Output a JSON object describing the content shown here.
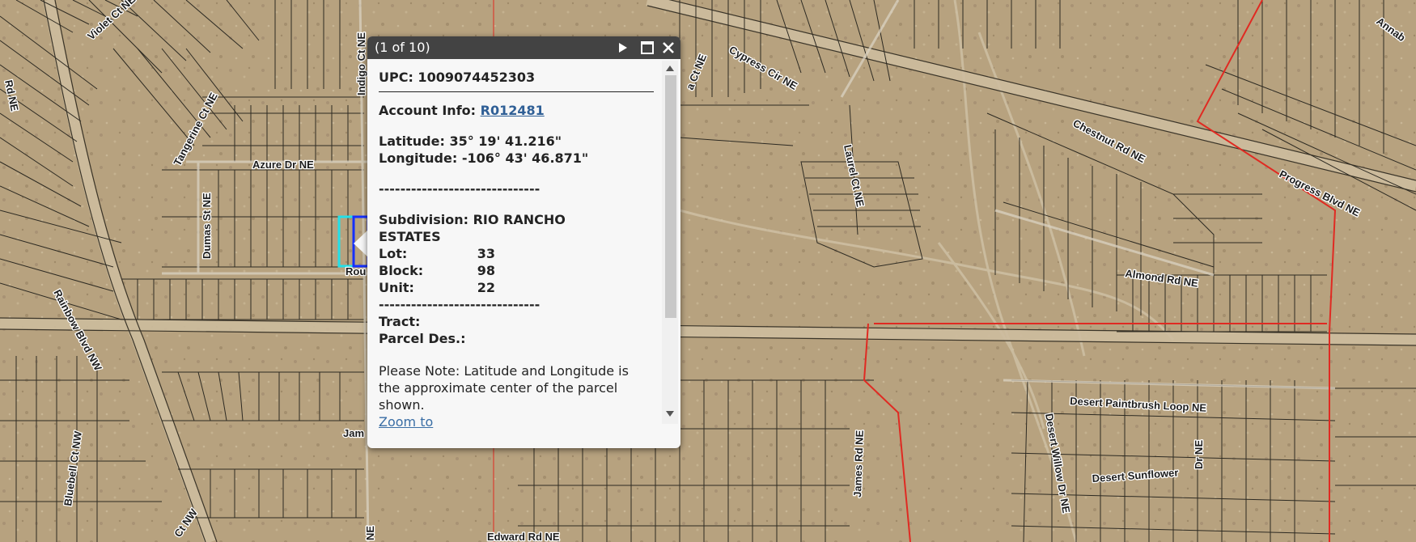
{
  "map": {
    "labels": {
      "violet_ct": "Violet Ct NE",
      "indigo_ct": "Indigo Ct NE",
      "tangerine_ct": "Tangerine Ct NE",
      "azure_dr": "Azure Dr NE",
      "dumas_st": "Dumas St NE",
      "rd_ne_left": "Rd NE",
      "rainbow_blvd": "Rainbow Blvd NW",
      "cypress_cir": "Cypress Cir NE",
      "a_ct": "a Ct NE",
      "laurel_ct": "Laurel Ct NE",
      "chestnut_rd": "Chestnut Rd NE",
      "progress_blvd": "Progress Blvd NE",
      "almond_rd": "Almond Rd NE",
      "desert_paintbrush": "Desert Paintbrush Loop NE",
      "desert_willow": "Desert Willow Dr NE",
      "desert_sunflower": "Desert Sunflower",
      "dr_ne": "Dr NE",
      "james_rd": "James Rd NE",
      "edward_rd": "Edward Rd NE",
      "bluebell_ct": "Bluebell Ct NW",
      "ct_nw": "Ct NW",
      "annab": "Annab",
      "rou": "Rou",
      "jam": "Jam",
      "ne_bottom": "NE"
    }
  },
  "popup": {
    "title": "(1 of 10)",
    "upc": "UPC: 1009074452303",
    "account_label": "Account Info:",
    "account_link": "R012481",
    "latitude": "Latitude: 35° 19' 41.216\"",
    "longitude": "Longitude: -106° 43' 46.871\"",
    "separator": "------------------------------",
    "subdivision_line1": "Subdivision: RIO RANCHO",
    "subdivision_line2": "ESTATES",
    "lot_label": "Lot:",
    "lot_value": "33",
    "block_label": "Block:",
    "block_value": "98",
    "unit_label": "Unit:",
    "unit_value": "22",
    "tract_label": "Tract:",
    "parcel_label": "Parcel Des.:",
    "note": "Please Note: Latitude and Longitude is the approximate center of the parcel shown.",
    "zoom_link": "Zoom to",
    "icons": {
      "next": "play-triangle-icon",
      "maximize": "maximize-window-icon",
      "close": "close-x-icon"
    }
  }
}
